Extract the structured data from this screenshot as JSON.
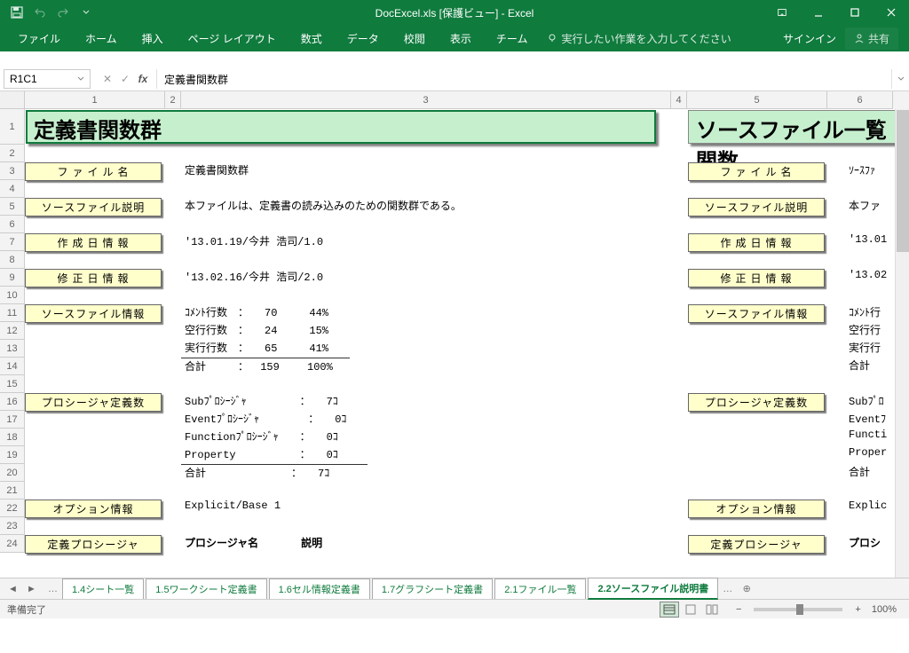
{
  "title": "DocExcel.xls [保護ビュー] - Excel",
  "qat": {
    "save": "保存",
    "undo": "元に戻す",
    "redo": "やり直し"
  },
  "ribbon": {
    "file": "ファイル",
    "home": "ホーム",
    "insert": "挿入",
    "pagelayout": "ページ レイアウト",
    "formulas": "数式",
    "data": "データ",
    "review": "校閲",
    "view": "表示",
    "team": "チーム",
    "tellme": "実行したい作業を入力してください",
    "signin": "サインイン",
    "share": "共有"
  },
  "namebox": "R1C1",
  "formula": "定義書関数群",
  "columns": [
    "1",
    "2",
    "3",
    "4",
    "5",
    "6"
  ],
  "rows": [
    "1",
    "2",
    "3",
    "4",
    "5",
    "6",
    "7",
    "8",
    "9",
    "10",
    "11",
    "12",
    "13",
    "14",
    "15",
    "16",
    "17",
    "18",
    "19",
    "20",
    "21",
    "22",
    "23",
    "24"
  ],
  "sheet": {
    "title1": "定義書関数群",
    "title2": "ソースファイル一覧関数",
    "labels": {
      "filename": "フ ァ イ ル 名",
      "sourcedesc": "ソースファイル説明",
      "createdate": "作 成 日 情 報",
      "moddate": "修 正 日 情 報",
      "sourceinfo": "ソースファイル情報",
      "procdef": "プロシージャ定義数",
      "optinfo": "オプション情報",
      "defproc": "定義プロシージャ"
    },
    "values": {
      "filename": "定義書関数群",
      "sourcedesc": "本ファイルは、定義書の読み込みのための関数群である。",
      "createdate": "'13.01.19/今井 浩司/1.0",
      "moddate": "'13.02.16/今井 浩司/2.0",
      "si1": "ｺﾒﾝﾄ行数　：　　70　　　44%",
      "si2": "空行行数　：　　24　　　15%",
      "si3": "実行行数　：　　65　　　41%",
      "si4": "合計　　　：　 159　　 100%",
      "pd1": "Subﾌﾟﾛｼｰｼﾞｬ　　　　　：　　7ｺ",
      "pd2": "Eventﾌﾟﾛｼｰｼﾞｬ　　　 　：　　0ｺ",
      "pd3": "Functionﾌﾟﾛｼｰｼﾞｬ　　：　　0ｺ",
      "pd4": "Property　　　　　　：　　0ｺ",
      "pd5": "合計　　　　　　　　：　　7ｺ",
      "opt": "Explicit/Base 1",
      "prochdr": "プロシージャ名　　　　説明",
      "r_filename": "ｿｰｽﾌｧ",
      "r_sourcedesc": "本ファ",
      "r_createdate": "'13.01",
      "r_moddate": "'13.02",
      "r_si1": "ｺﾒﾝﾄ行",
      "r_si2": "空行行",
      "r_si3": "実行行",
      "r_si4": "合計",
      "r_pd1": "Subﾌﾟﾛ",
      "r_pd2": "Eventﾌ",
      "r_pd3": "Functi",
      "r_pd4": "Proper",
      "r_pd5": "合計",
      "r_opt": "Explic",
      "r_prochdr": "プロシ"
    }
  },
  "tabs": [
    "1.4シート一覧",
    "1.5ワークシート定義書",
    "1.6セル情報定義書",
    "1.7グラフシート定義書",
    "2.1ファイル一覧",
    "2.2ソースファイル説明書"
  ],
  "active_tab": 5,
  "status": "準備完了",
  "zoom": "100%"
}
